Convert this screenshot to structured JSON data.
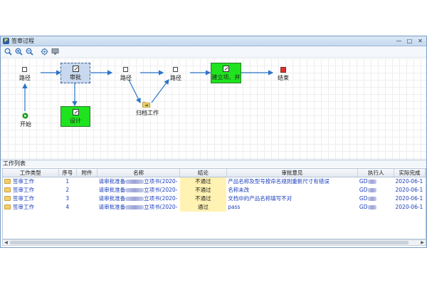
{
  "window": {
    "title": "签审过程",
    "app_icon": "P",
    "controls": [
      "minimize",
      "restore",
      "close"
    ]
  },
  "toolbar": {
    "buttons": [
      {
        "name": "zoom-fit-icon"
      },
      {
        "name": "zoom-in-icon"
      },
      {
        "name": "zoom-out-icon"
      },
      {
        "name": "settings-icon"
      },
      {
        "name": "monitor-icon"
      }
    ]
  },
  "workflow": {
    "nodes": {
      "path1": "路径",
      "approve": "审批",
      "start": "开始",
      "design": "设计",
      "path2": "路径",
      "archive": "归档工作",
      "path3": "路径",
      "setup": "建立项、并",
      "end": "结束"
    },
    "colors": {
      "active_green": "#1ee31e",
      "selected_box": "#c8d8ee",
      "arrow": "#2b74c9",
      "start": "#1c9a1c",
      "end": "#e03030"
    }
  },
  "work_list": {
    "title": "工作列表",
    "columns": [
      "工作类型",
      "序号",
      "附件",
      "名称",
      "结论",
      "审批意见",
      "执行人",
      "实际完成"
    ],
    "rows": [
      {
        "type": "签审工作",
        "seq": "1",
        "attach": "",
        "name_pre": "请审批准备",
        "name_post": "立项书(2020-",
        "conclusion": "不通过",
        "opinion": "产品名称及型号按命名规则重新尺寸有错误",
        "executor": "GD",
        "done": "2020-06-1"
      },
      {
        "type": "签审工作",
        "seq": "2",
        "attach": "",
        "name_pre": "请审批准备",
        "name_post": "立项书(2020-",
        "conclusion": "不通过",
        "opinion": "名称未改",
        "executor": "GD",
        "done": "2020-06-1"
      },
      {
        "type": "签审工作",
        "seq": "3",
        "attach": "",
        "name_pre": "请审批准备",
        "name_post": "立项书(2020-",
        "conclusion": "不通过",
        "opinion": "文档中的产品名称填写不对",
        "executor": "GD",
        "done": "2020-06-1"
      },
      {
        "type": "签审工作",
        "seq": "4",
        "attach": "",
        "name_pre": "请审批准备",
        "name_post": "立项书(2020-",
        "conclusion": "通过",
        "opinion": "pass",
        "executor": "GD",
        "done": "2020-06-1"
      }
    ]
  }
}
